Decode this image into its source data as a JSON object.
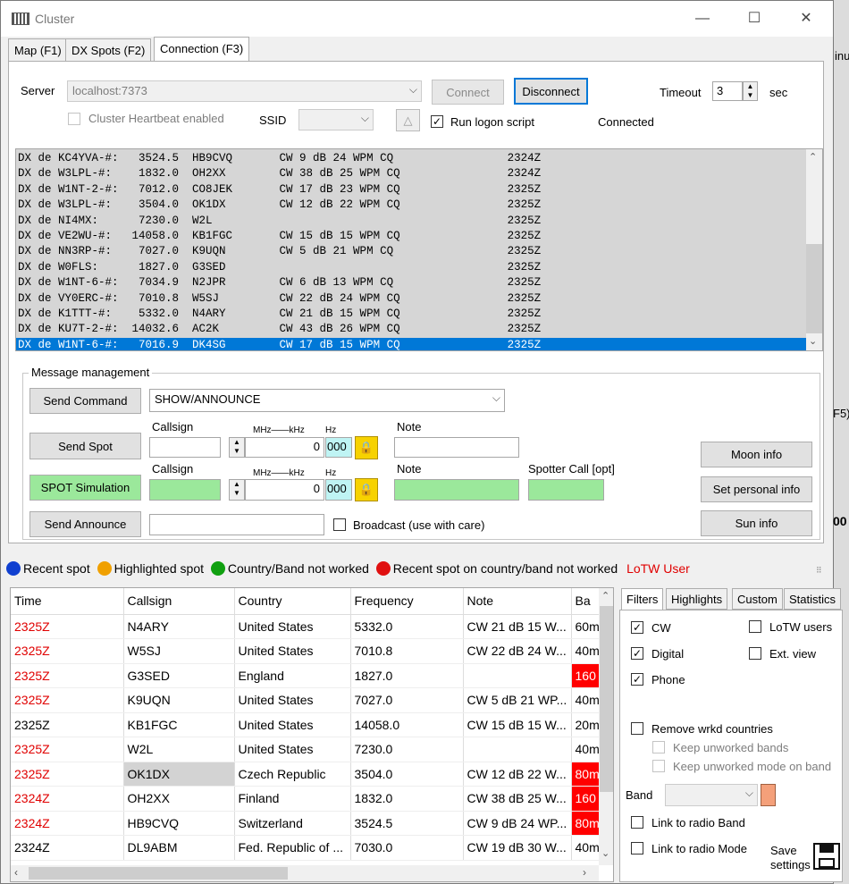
{
  "window": {
    "title": "Cluster",
    "min": "—",
    "max": "☐",
    "close": "✕"
  },
  "tabs": [
    "Map (F1)",
    "DX Spots (F2)",
    "Connection (F3)"
  ],
  "server": {
    "label": "Server",
    "value": "localhost:7373",
    "connect": "Connect",
    "disconnect": "Disconnect",
    "timeout_label": "Timeout",
    "timeout_value": "3",
    "timeout_unit": "sec",
    "heartbeat": "Cluster Heartbeat enabled",
    "ssid_label": "SSID",
    "logon": "Run logon script",
    "status": "Connected"
  },
  "spots": [
    "DX de KC4YVA-#:   3524.5  HB9CVQ       CW 9 dB 24 WPM CQ                 2324Z",
    "DX de W3LPL-#:    1832.0  OH2XX        CW 38 dB 25 WPM CQ                2324Z",
    "DX de W1NT-2-#:   7012.0  CO8JEK       CW 17 dB 23 WPM CQ                2325Z",
    "DX de W3LPL-#:    3504.0  OK1DX        CW 12 dB 22 WPM CQ                2325Z",
    "DX de NI4MX:      7230.0  W2L                                            2325Z",
    "DX de VE2WU-#:   14058.0  KB1FGC       CW 15 dB 15 WPM CQ                2325Z",
    "DX de NN3RP-#:    7027.0  K9UQN        CW 5 dB 21 WPM CQ                 2325Z",
    "DX de W0FLS:      1827.0  G3SED                                          2325Z",
    "DX de W1NT-6-#:   7034.9  N2JPR        CW 6 dB 13 WPM CQ                 2325Z",
    "DX de VY0ERC-#:   7010.8  W5SJ         CW 22 dB 24 WPM CQ                2325Z",
    "DX de K1TTT-#:    5332.0  N4ARY        CW 21 dB 15 WPM CQ                2325Z",
    "DX de KU7T-2-#:  14032.6  AC2K         CW 43 dB 26 WPM CQ                2325Z",
    "DX de W1NT-6-#:   7016.9  DK4SG        CW 17 dB 15 WPM CQ                2325Z"
  ],
  "msg": {
    "group": "Message management",
    "send_command": "Send Command",
    "command_value": "SHOW/ANNOUNCE",
    "send_spot": "Send Spot",
    "spot_sim": "SPOT Simulation",
    "send_announce": "Send Announce",
    "callsign": "Callsign",
    "mhz_khz": "MHz——kHz",
    "hz": "Hz",
    "freq_value": "0",
    "hz_value": "000",
    "note": "Note",
    "spotter": "Spotter Call [opt]",
    "broadcast": "Broadcast (use with care)",
    "moon": "Moon info",
    "personal": "Set personal info",
    "sun": "Sun info"
  },
  "legend": {
    "recent": "Recent spot",
    "highlighted": "Highlighted spot",
    "notworked": "Country/Band not worked",
    "recent_nw": "Recent spot on country/band not worked",
    "lotw": "LoTW User",
    "colors": {
      "blue": "#1040d0",
      "orange": "#f0a000",
      "green": "#10a010",
      "red": "#e01010",
      "lotw": "#e00000"
    }
  },
  "grid": {
    "headers": [
      "Time",
      "Callsign",
      "Country",
      "Frequency",
      "Note",
      "Ba"
    ],
    "rows": [
      {
        "time": "2325Z",
        "call": "N4ARY",
        "country": "United States",
        "freq": "5332.0",
        "note": "CW 21 dB 15 W...",
        "band": "60m",
        "recent": true,
        "bandred": false,
        "sel": false
      },
      {
        "time": "2325Z",
        "call": "W5SJ",
        "country": "United States",
        "freq": "7010.8",
        "note": "CW 22 dB 24 W...",
        "band": "40m",
        "recent": true,
        "bandred": false,
        "sel": false
      },
      {
        "time": "2325Z",
        "call": "G3SED",
        "country": "England",
        "freq": "1827.0",
        "note": "",
        "band": "160",
        "recent": true,
        "bandred": true,
        "sel": false
      },
      {
        "time": "2325Z",
        "call": "K9UQN",
        "country": "United States",
        "freq": "7027.0",
        "note": "CW 5 dB 21 WP...",
        "band": "40m",
        "recent": true,
        "bandred": false,
        "sel": false
      },
      {
        "time": "2325Z",
        "call": "KB1FGC",
        "country": "United States",
        "freq": "14058.0",
        "note": "CW 15 dB 15 W...",
        "band": "20m",
        "recent": false,
        "bandred": false,
        "sel": false
      },
      {
        "time": "2325Z",
        "call": "W2L",
        "country": "United States",
        "freq": "7230.0",
        "note": "",
        "band": "40m",
        "recent": true,
        "bandred": false,
        "sel": false
      },
      {
        "time": "2325Z",
        "call": "OK1DX",
        "country": "Czech Republic",
        "freq": "3504.0",
        "note": "CW 12 dB 22 W...",
        "band": "80m",
        "recent": true,
        "bandred": true,
        "sel": true
      },
      {
        "time": "2324Z",
        "call": "OH2XX",
        "country": "Finland",
        "freq": "1832.0",
        "note": "CW 38 dB 25 W...",
        "band": "160",
        "recent": true,
        "bandred": true,
        "sel": false
      },
      {
        "time": "2324Z",
        "call": "HB9CVQ",
        "country": "Switzerland",
        "freq": "3524.5",
        "note": "CW 9 dB 24 WP...",
        "band": "80m",
        "recent": true,
        "bandred": true,
        "sel": false
      },
      {
        "time": "2324Z",
        "call": "DL9ABM",
        "country": "Fed. Republic of ...",
        "freq": "7030.0",
        "note": "CW 19 dB 30 W...",
        "band": "40m",
        "recent": false,
        "bandred": false,
        "sel": false
      }
    ]
  },
  "rtabs": [
    "Filters",
    "Highlights",
    "Custom",
    "Statistics"
  ],
  "filters": {
    "cw": "CW",
    "digital": "Digital",
    "phone": "Phone",
    "lotw": "LoTW users",
    "ext": "Ext. view",
    "remove": "Remove wrkd countries",
    "keep_bands": "Keep unworked bands",
    "keep_mode": "Keep unworked mode on band",
    "band": "Band",
    "link_band": "Link to radio Band",
    "link_mode": "Link to radio Mode",
    "save": "Save",
    "settings": "settings"
  },
  "right_edge": {
    "inu": "inu",
    "f5": "F5)",
    "oo": "00"
  }
}
